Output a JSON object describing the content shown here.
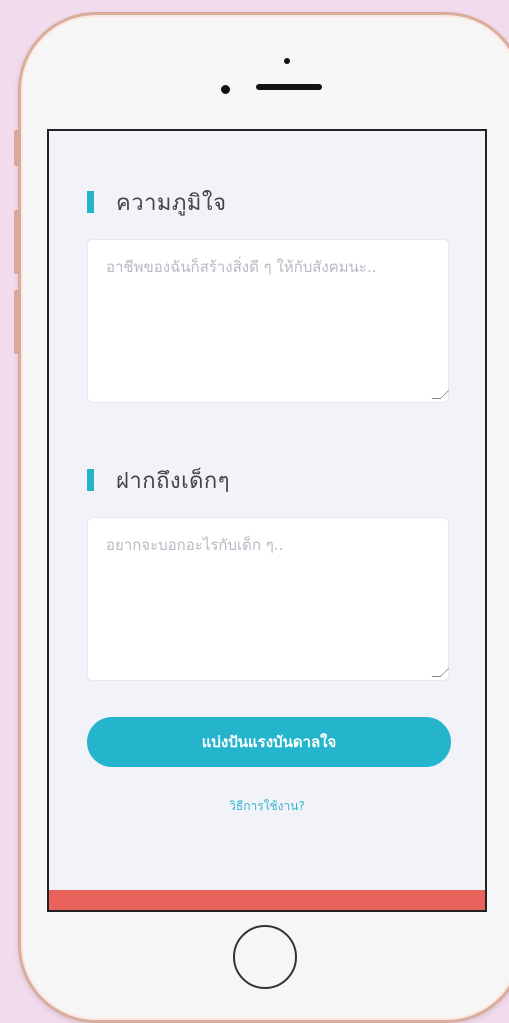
{
  "pride": {
    "title": "ความภูมิใจ",
    "placeholder": "อาชีพของฉันก็สร้างสิ่งดี ๆ ให้กับสังคมนะ.."
  },
  "message": {
    "title": "ฝากถึงเด็กๆ",
    "placeholder": "อยากจะบอกอะไรกับเด็ก ๆ.."
  },
  "share_button_label": "แบ่งปันแรงบันดาลใจ",
  "howto_link": "วิธีการใช้งาน?",
  "colors": {
    "accent": "#24b5cc",
    "footer": "#e9625b",
    "background": "#f3dbee"
  }
}
